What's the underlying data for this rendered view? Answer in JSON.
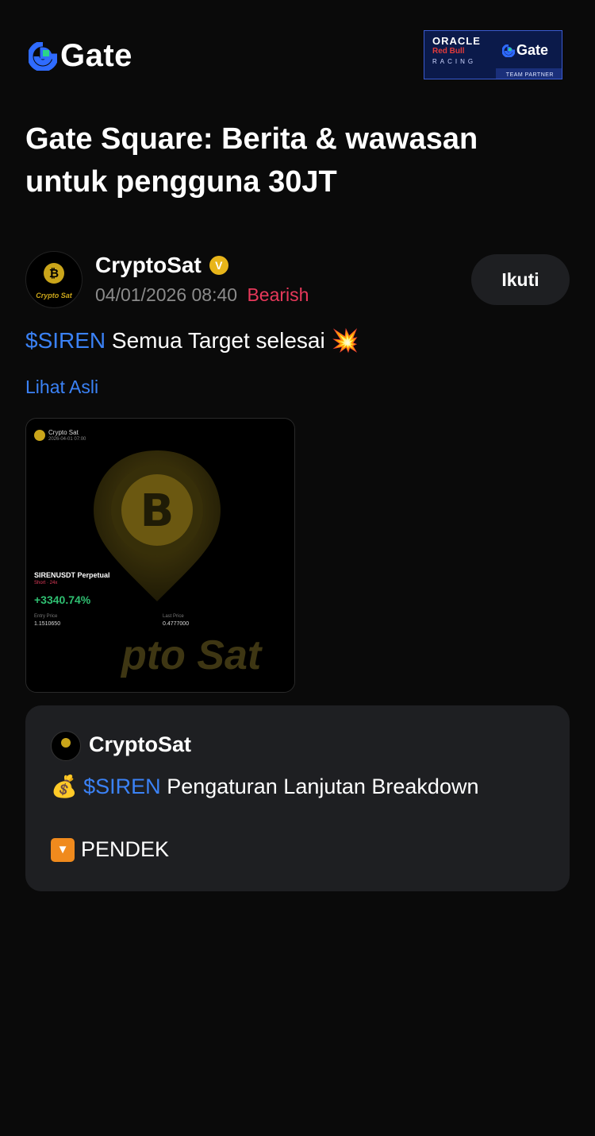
{
  "brand": {
    "logo_text": "Gate"
  },
  "partner_badge": {
    "oracle": "ORACLE",
    "redbull": "Red Bull",
    "racing": "RACING",
    "gate": "Gate",
    "partner": "TEAM PARTNER"
  },
  "page_title": "Gate Square: Berita & wawasan untuk pengguna 30JT",
  "post": {
    "author": "CryptoSat",
    "avatar_text": "Crypto Sat",
    "datetime": "04/01/2026 08:40",
    "sentiment": "Bearish",
    "follow_label": "Ikuti",
    "ticker": "$SIREN",
    "text": " Semua Target selesai 💥",
    "view_original": "Lihat Asli",
    "image": {
      "name": "Crypto Sat",
      "date": "2026-04-01 07:00",
      "pair": "SIRENUSDT Perpetual",
      "tag": "Short · 24x",
      "pnl": "+3340.74%",
      "entry_label": "Entry Price",
      "entry_value": "1.1510650",
      "last_label": "Last Price",
      "last_value": "0.4777000",
      "watermark": "pto Sat"
    }
  },
  "quoted": {
    "author": "CryptoSat",
    "line1_emoji": "💰",
    "ticker": "$SIREN",
    "line1_text": " Pengaturan Lanjutan Breakdown",
    "line2_icon": "▼",
    "line2_text": "PENDEK"
  },
  "colors": {
    "accent_blue": "#3b82f6",
    "bearish": "#e8395b",
    "gold": "#caa51a"
  },
  "icons": [
    "gate-logo-icon",
    "verified-icon",
    "down-arrow-icon",
    "money-bag-icon"
  ]
}
